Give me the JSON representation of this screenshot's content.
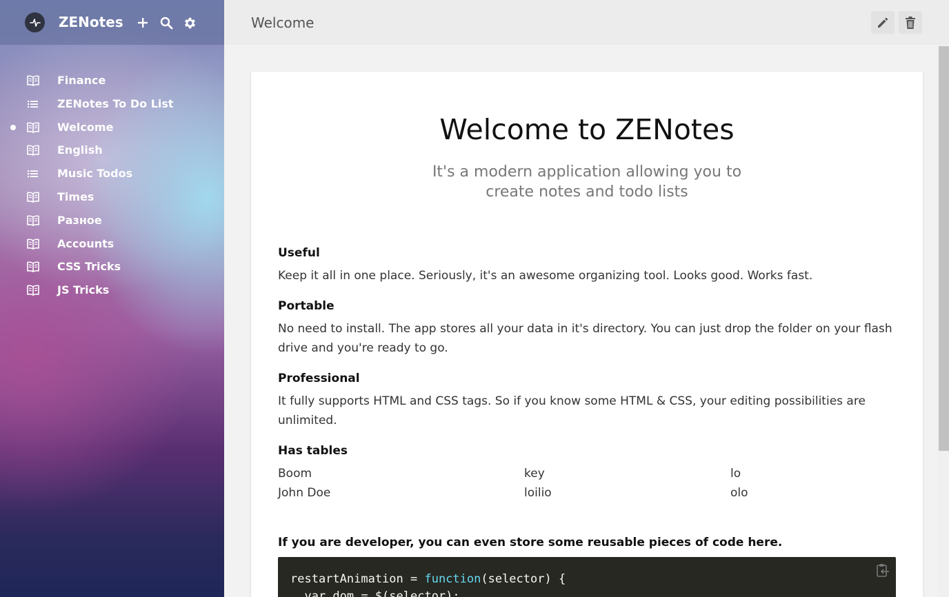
{
  "app": {
    "title": "ZENotes",
    "logo_icon": "pulse-logo-icon"
  },
  "header_actions": [
    {
      "name": "add-note",
      "icon": "plus-icon"
    },
    {
      "name": "search",
      "icon": "search-icon"
    },
    {
      "name": "settings",
      "icon": "gear-icon"
    }
  ],
  "sidebar": {
    "items": [
      {
        "label": "Finance",
        "icon": "book-icon",
        "active": false
      },
      {
        "label": "ZENotes To Do List",
        "icon": "list-icon",
        "active": false
      },
      {
        "label": "Welcome",
        "icon": "book-icon",
        "active": true
      },
      {
        "label": "English",
        "icon": "book-icon",
        "active": false
      },
      {
        "label": "Music Todos",
        "icon": "list-icon",
        "active": false
      },
      {
        "label": "Times",
        "icon": "book-icon",
        "active": false
      },
      {
        "label": "Разное",
        "icon": "book-icon",
        "active": false
      },
      {
        "label": "Accounts",
        "icon": "book-icon",
        "active": false
      },
      {
        "label": "CSS Tricks",
        "icon": "book-icon",
        "active": false
      },
      {
        "label": "JS Tricks",
        "icon": "book-icon",
        "active": false
      }
    ]
  },
  "topbar": {
    "title": "Welcome",
    "edit_icon": "pencil-icon",
    "delete_icon": "trash-icon"
  },
  "note": {
    "title": "Welcome to ZENotes",
    "subtitle": "It's a modern application allowing you to create notes and todo lists",
    "sections": [
      {
        "heading": "Useful",
        "text": "Keep it all in one place. Seriously, it's an awesome organizing tool. Looks good. Works fast."
      },
      {
        "heading": "Portable",
        "text": "No need to install. The app stores all your data in it's directory. You can just drop the folder on your flash drive and you're ready to go."
      },
      {
        "heading": "Professional",
        "text": "It fully supports HTML and CSS tags. So if you know some HTML & CSS, your editing possibilities are unlimited."
      },
      {
        "heading": "Has tables",
        "text": ""
      }
    ],
    "table": {
      "rows": [
        [
          "Boom",
          "key",
          "lo"
        ],
        [
          "John Doe",
          "loilio",
          "olo"
        ]
      ]
    },
    "developer_heading": "If you are developer, you can even store some reusable pieces of code here.",
    "code": {
      "line1_a": "restartAnimation = ",
      "line1_kw": "function",
      "line1_b": "(selector) {",
      "line2": "  var dom = $(selector);",
      "copy_icon": "clipboard-icon"
    }
  },
  "colors": {
    "accent": "#2f3340",
    "code_bg": "#272822",
    "keyword": "#66d9ef"
  }
}
